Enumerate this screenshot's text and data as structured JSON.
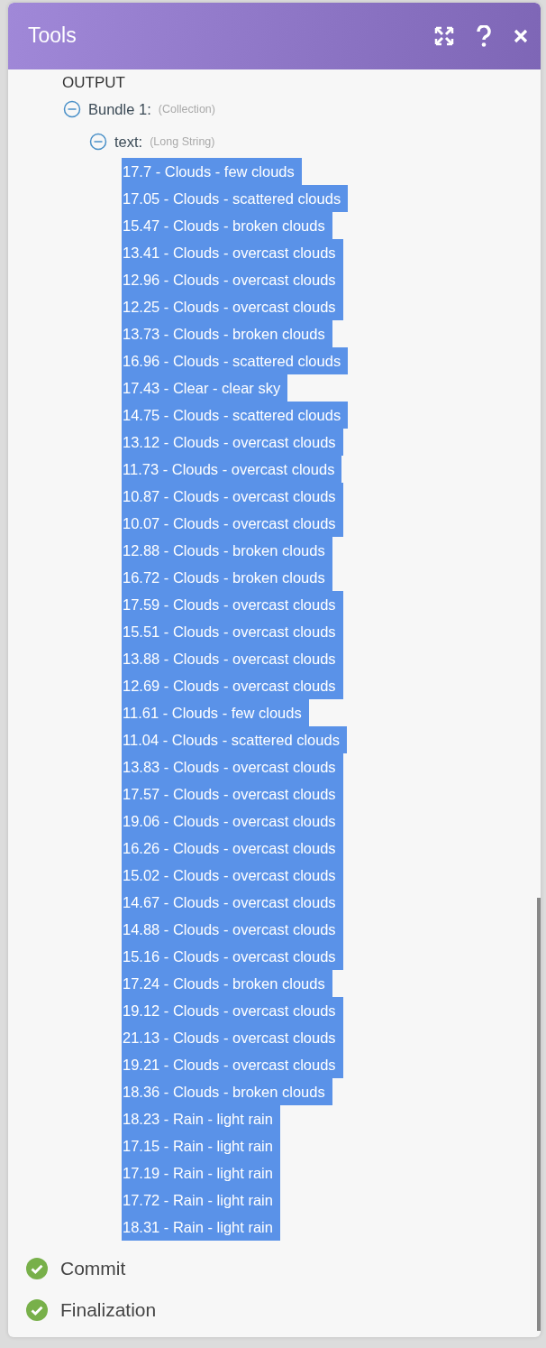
{
  "window": {
    "title": "Tools"
  },
  "output": {
    "heading": "OUTPUT",
    "bundle": {
      "label": "Bundle 1:",
      "type": "(Collection)",
      "expanded": true,
      "field": {
        "label": "text:",
        "type": "(Long String)",
        "expanded": true,
        "selected": true,
        "lines": [
          "17.7 - Clouds - few clouds",
          "17.05 - Clouds - scattered clouds",
          "15.47 - Clouds - broken clouds",
          "13.41 - Clouds - overcast clouds",
          "12.96 - Clouds - overcast clouds",
          "12.25 - Clouds - overcast clouds",
          "13.73 - Clouds - broken clouds",
          "16.96 - Clouds - scattered clouds",
          "17.43 - Clear - clear sky",
          "14.75 - Clouds - scattered clouds",
          "13.12 - Clouds - overcast clouds",
          "11.73 - Clouds - overcast clouds",
          "10.87 - Clouds - overcast clouds",
          "10.07 - Clouds - overcast clouds",
          "12.88 - Clouds - broken clouds",
          "16.72 - Clouds - broken clouds",
          "17.59 - Clouds - overcast clouds",
          "15.51 - Clouds - overcast clouds",
          "13.88 - Clouds - overcast clouds",
          "12.69 - Clouds - overcast clouds",
          "11.61 - Clouds - few clouds",
          "11.04 - Clouds - scattered clouds",
          "13.83 - Clouds - overcast clouds",
          "17.57 - Clouds - overcast clouds",
          "19.06 - Clouds - overcast clouds",
          "16.26 - Clouds - overcast clouds",
          "15.02 - Clouds - overcast clouds",
          "14.67 - Clouds - overcast clouds",
          "14.88 - Clouds - overcast clouds",
          "15.16 - Clouds - overcast clouds",
          "17.24 - Clouds - broken clouds",
          "19.12 - Clouds - overcast clouds",
          "21.13 - Clouds - overcast clouds",
          "19.21 - Clouds - overcast clouds",
          "18.36 - Clouds - broken clouds",
          "18.23 - Rain - light rain",
          "17.15 - Rain - light rain",
          "17.19 - Rain - light rain",
          "17.72 - Rain - light rain",
          "18.31 - Rain - light rain"
        ]
      }
    }
  },
  "steps": [
    {
      "label": "Commit",
      "done": true
    },
    {
      "label": "Finalization",
      "done": true
    }
  ]
}
